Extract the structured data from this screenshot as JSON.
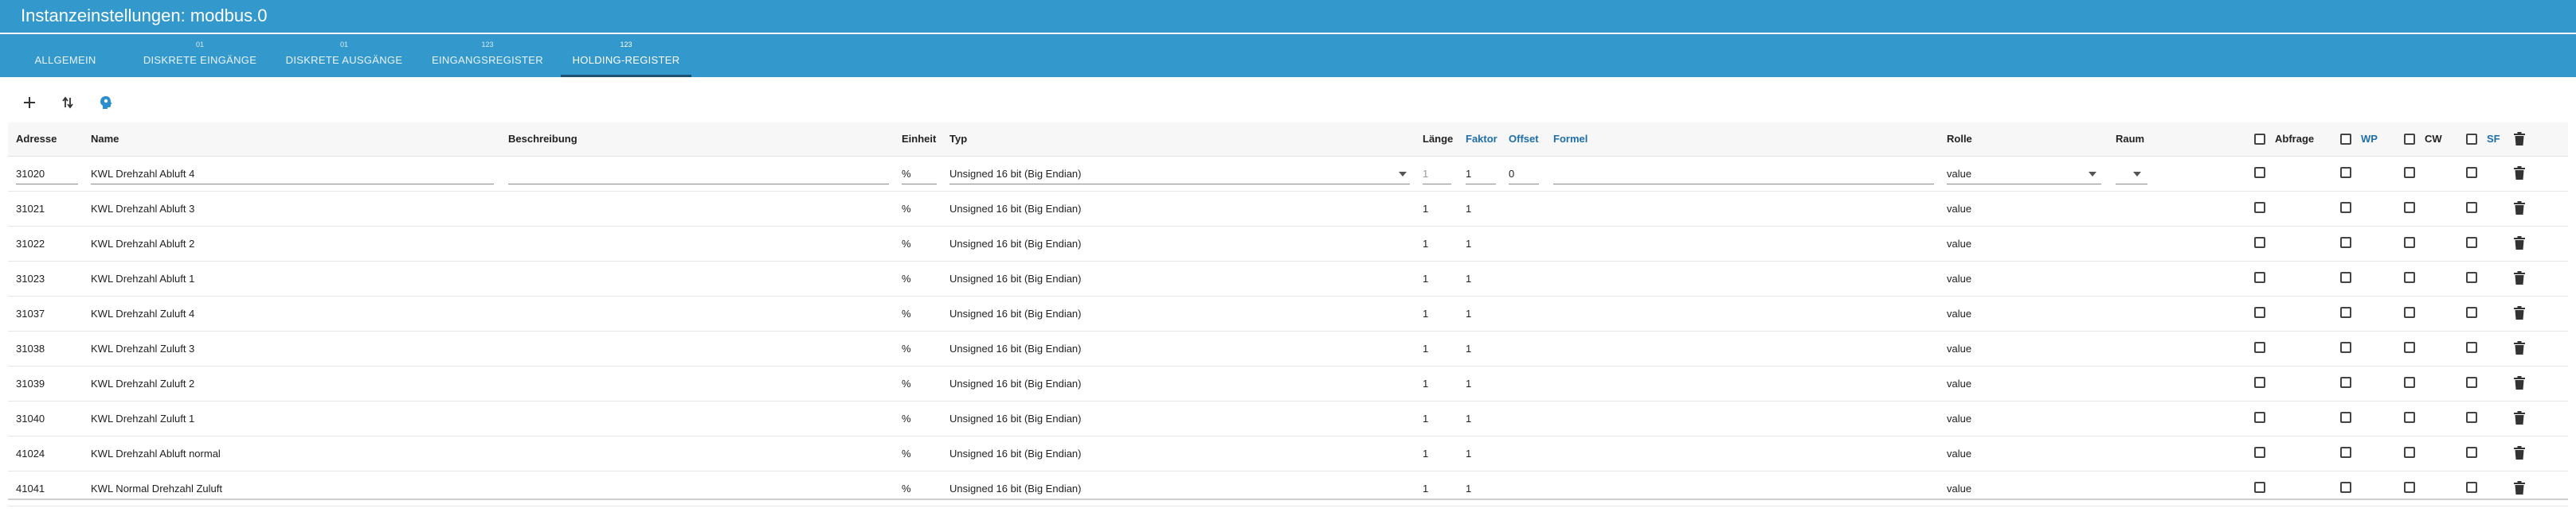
{
  "window": {
    "title": "Instanzeinstellungen: modbus.0"
  },
  "tabs": [
    {
      "badge": "",
      "label": "ALLGEMEIN"
    },
    {
      "badge": "01",
      "label": "DISKRETE EINGÄNGE"
    },
    {
      "badge": "01",
      "label": "DISKRETE AUSGÄNGE"
    },
    {
      "badge": "123",
      "label": "EINGANGSREGISTER"
    },
    {
      "badge": "123",
      "label": "HOLDING-REGISTER"
    }
  ],
  "active_tab": "HOLDING-REGISTER",
  "toolbar": {
    "add_icon": "plus-icon",
    "sort_icon": "sort-arrows-icon",
    "import_icon": "head-icon"
  },
  "columns": {
    "adresse": "Adresse",
    "name": "Name",
    "beschreibung": "Beschreibung",
    "einheit": "Einheit",
    "typ": "Typ",
    "laenge": "Länge",
    "faktor": "Faktor",
    "offset": "Offset",
    "formel": "Formel",
    "rolle": "Rolle",
    "raum": "Raum",
    "abfrage": "Abfrage",
    "wp": "WP",
    "cw": "CW",
    "sf": "SF"
  },
  "rows": [
    {
      "adresse": "31020",
      "name": "KWL Drehzahl Abluft 4",
      "beschreibung": "",
      "einheit": "%",
      "typ": "Unsigned 16 bit (Big Endian)",
      "laenge": "1",
      "faktor": "1",
      "offset": "0",
      "formel": "",
      "rolle": "value",
      "raum": ""
    },
    {
      "adresse": "31021",
      "name": "KWL Drehzahl Abluft 3",
      "beschreibung": "",
      "einheit": "%",
      "typ": "Unsigned 16 bit (Big Endian)",
      "laenge": "1",
      "faktor": "1",
      "offset": "",
      "formel": "",
      "rolle": "value",
      "raum": ""
    },
    {
      "adresse": "31022",
      "name": "KWL Drehzahl Abluft 2",
      "beschreibung": "",
      "einheit": "%",
      "typ": "Unsigned 16 bit (Big Endian)",
      "laenge": "1",
      "faktor": "1",
      "offset": "",
      "formel": "",
      "rolle": "value",
      "raum": ""
    },
    {
      "adresse": "31023",
      "name": "KWL Drehzahl Abluft 1",
      "beschreibung": "",
      "einheit": "%",
      "typ": "Unsigned 16 bit (Big Endian)",
      "laenge": "1",
      "faktor": "1",
      "offset": "",
      "formel": "",
      "rolle": "value",
      "raum": ""
    },
    {
      "adresse": "31037",
      "name": "KWL Drehzahl Zuluft 4",
      "beschreibung": "",
      "einheit": "%",
      "typ": "Unsigned 16 bit (Big Endian)",
      "laenge": "1",
      "faktor": "1",
      "offset": "",
      "formel": "",
      "rolle": "value",
      "raum": ""
    },
    {
      "adresse": "31038",
      "name": "KWL Drehzahl Zuluft 3",
      "beschreibung": "",
      "einheit": "%",
      "typ": "Unsigned 16 bit (Big Endian)",
      "laenge": "1",
      "faktor": "1",
      "offset": "",
      "formel": "",
      "rolle": "value",
      "raum": ""
    },
    {
      "adresse": "31039",
      "name": "KWL Drehzahl Zuluft 2",
      "beschreibung": "",
      "einheit": "%",
      "typ": "Unsigned 16 bit (Big Endian)",
      "laenge": "1",
      "faktor": "1",
      "offset": "",
      "formel": "",
      "rolle": "value",
      "raum": ""
    },
    {
      "adresse": "31040",
      "name": "KWL Drehzahl Zuluft 1",
      "beschreibung": "",
      "einheit": "%",
      "typ": "Unsigned 16 bit (Big Endian)",
      "laenge": "1",
      "faktor": "1",
      "offset": "",
      "formel": "",
      "rolle": "value",
      "raum": ""
    },
    {
      "adresse": "41024",
      "name": "KWL Drehzahl Abluft normal",
      "beschreibung": "",
      "einheit": "%",
      "typ": "Unsigned 16 bit (Big Endian)",
      "laenge": "1",
      "faktor": "1",
      "offset": "",
      "formel": "",
      "rolle": "value",
      "raum": ""
    },
    {
      "adresse": "41041",
      "name": "KWL Normal Drehzahl Zuluft",
      "beschreibung": "",
      "einheit": "%",
      "typ": "Unsigned 16 bit (Big Endian)",
      "laenge": "1",
      "faktor": "1",
      "offset": "",
      "formel": "",
      "rolle": "value",
      "raum": ""
    }
  ],
  "colors": {
    "header_bg": "#3399cc",
    "active_tab_underline": "#1d4f73",
    "blue_header_text": "#1e6ea8"
  }
}
